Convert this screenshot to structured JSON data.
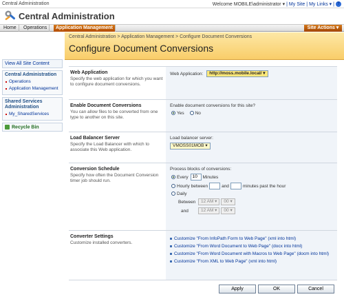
{
  "topbar": {
    "site_name": "Central Administration",
    "welcome": "Welcome MOBILE\\administrator ▾",
    "my_site": "My Site",
    "my_links": "My Links ▾",
    "help": "?"
  },
  "header": {
    "title": "Central Administration"
  },
  "tabs": [
    {
      "label": "Home"
    },
    {
      "label": "Operations"
    },
    {
      "label": "Application Management"
    }
  ],
  "site_actions": "Site Actions ▾",
  "breadcrumb": "Central Administration > Application Management > Configure Document Conversions",
  "page_title": "Configure Document Conversions",
  "nav": {
    "view_all": "View All Site Content",
    "groups": [
      {
        "title": "Central Administration",
        "items": [
          "Operations",
          "Application Management"
        ]
      },
      {
        "title": "Shared Services Administration",
        "items": [
          "My_SharedServices"
        ]
      }
    ],
    "recycle_bin": "Recycle Bin"
  },
  "sections": {
    "web_app": {
      "heading": "Web Application",
      "desc": "Specify the web application for which you want to configure document conversions.",
      "label": "Web Application:",
      "value": "http://moss.mobile.local/ ▾"
    },
    "enable": {
      "heading": "Enable Document Conversions",
      "desc": "You can allow files to be converted from one type to another on this site.",
      "question": "Enable document conversions for this site?",
      "yes": "Yes",
      "no": "No",
      "selected": "Yes"
    },
    "load_balancer": {
      "heading": "Load Balancer Server",
      "desc": "Specify the Load Balancer with which to associate this Web application.",
      "label": "Load balancer server:",
      "value": "VMOSS01MOB ▾"
    },
    "schedule": {
      "heading": "Conversion Schedule",
      "desc": "Specify how often the Document Conversion timer job should run.",
      "process_label": "Process blocks of conversions:",
      "every_label": "Every",
      "every_value": "10",
      "minutes_label": "Minutes",
      "hourly_label": "Hourly between",
      "and_label": "and",
      "past_hour_label": "minutes past the hour",
      "daily_label": "Daily",
      "between_label": "Between",
      "and2_label": "and",
      "time1_hour": "12 AM ▾",
      "time1_min": "00 ▾",
      "time2_hour": "12 AM ▾",
      "time2_min": "00 ▾",
      "selected": "Every"
    },
    "converters": {
      "heading": "Converter Settings",
      "desc": "Customize installed converters.",
      "links": [
        "Customize \"From InfoPath Form to Web Page\" (xml into html)",
        "Customize \"From Word Document to Web Page\" (docx into html)",
        "Customize \"From Word Document with Macros to Web Page\" (docm into html)",
        "Customize \"From XML to Web Page\" (xml into html)"
      ]
    }
  },
  "buttons": {
    "apply": "Apply",
    "ok": "OK",
    "cancel": "Cancel"
  }
}
